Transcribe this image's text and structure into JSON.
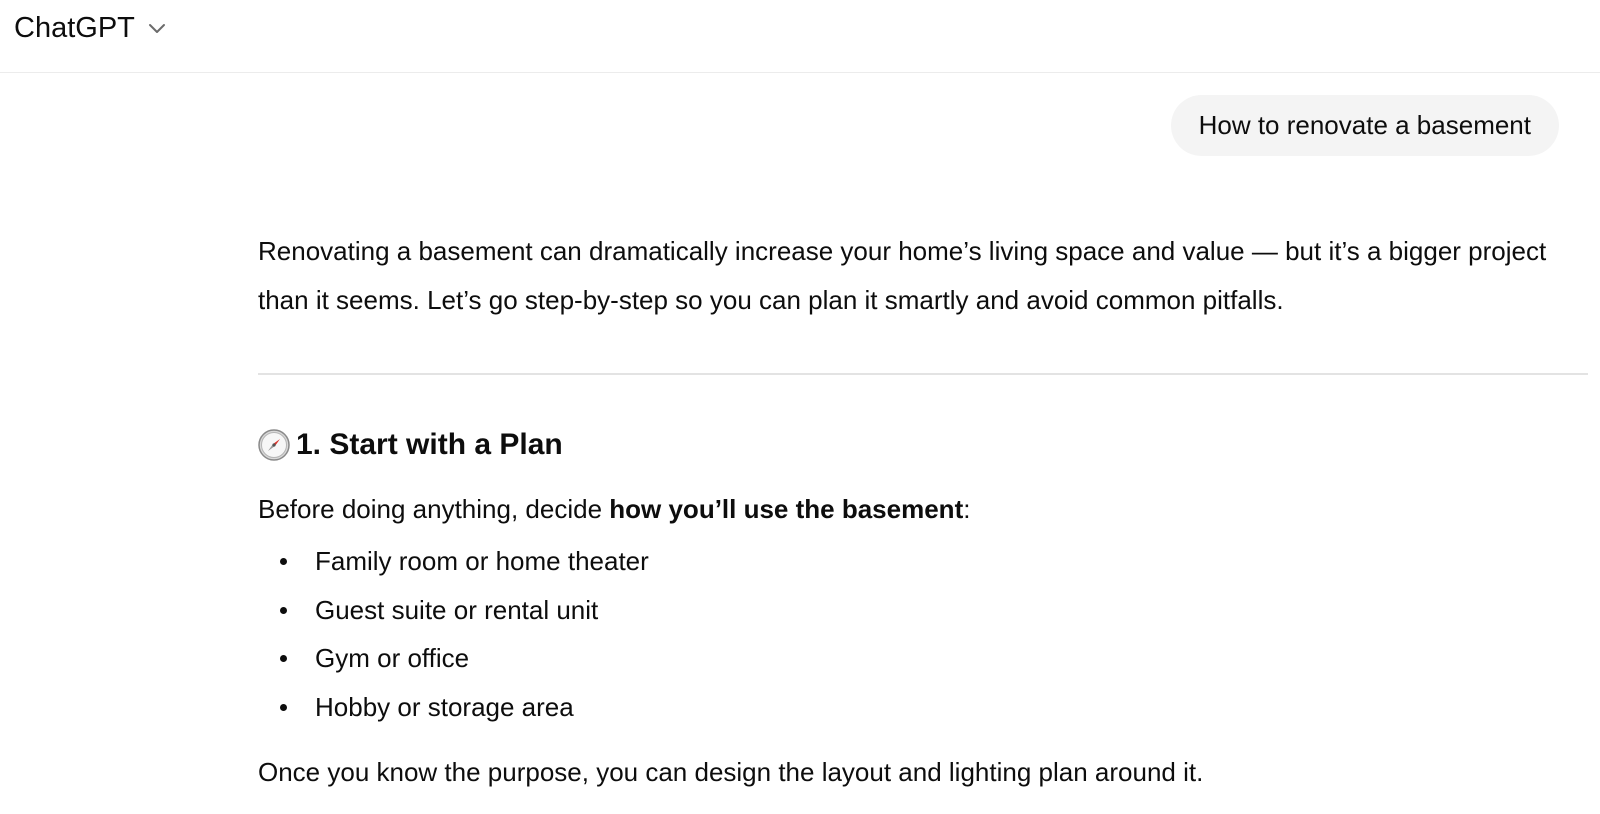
{
  "header": {
    "model_name": "ChatGPT",
    "chevron_icon": "chevron-down-icon"
  },
  "conversation": {
    "user_message": "How to renovate a basement",
    "assistant": {
      "intro": "Renovating a basement can dramatically increase your home’s living space and value — but it’s a bigger project than it seems. Let’s go step-by-step so you can plan it smartly and avoid common pitfalls.",
      "section": {
        "icon": "compass-icon",
        "heading": "1. Start with a Plan",
        "lead_before": "Before doing anything, decide ",
        "lead_bold": "how you’ll use the basement",
        "lead_after": ":",
        "bullets": [
          "Family room or home theater",
          "Guest suite or rental unit",
          "Gym or office",
          "Hobby or storage area"
        ],
        "outro": "Once you know the purpose, you can design the layout and lighting plan around it."
      }
    }
  }
}
